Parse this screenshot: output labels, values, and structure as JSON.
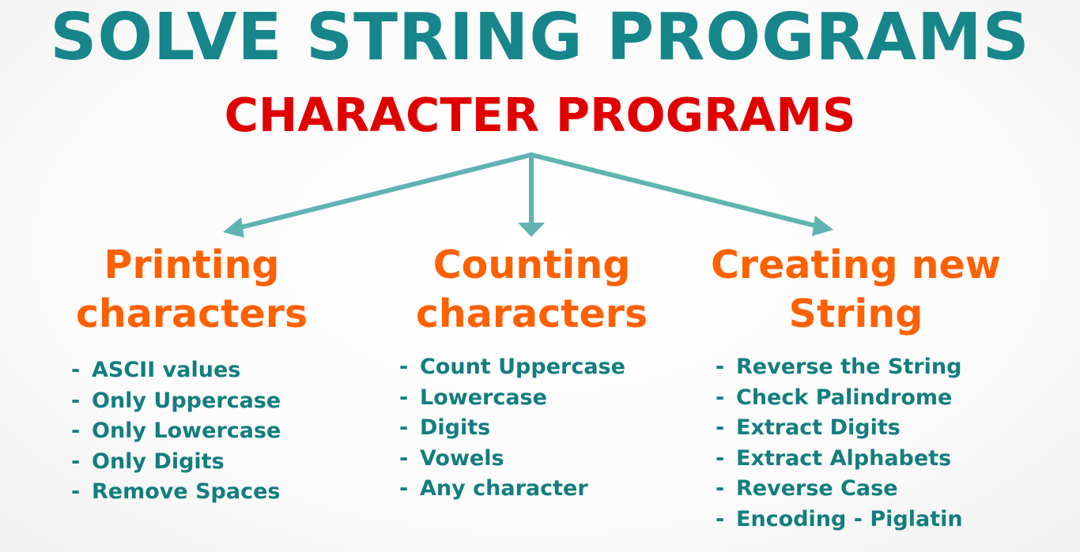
{
  "colors": {
    "teal": "#16868b",
    "red": "#e10000",
    "orange": "#ff6000",
    "arrow": "#5fb3b0",
    "item_text": "#137d7f"
  },
  "title": "SOLVE STRING PROGRAMS",
  "subtitle": "CHARACTER PROGRAMS",
  "categories": [
    {
      "heading_line1": "Printing",
      "heading_line2": "characters",
      "items": [
        "ASCII values",
        "Only Uppercase",
        "Only Lowercase",
        "Only Digits",
        "Remove Spaces"
      ]
    },
    {
      "heading_line1": "Counting",
      "heading_line2": "characters",
      "items": [
        "Count Uppercase",
        "Lowercase",
        "Digits",
        "Vowels",
        "Any character"
      ]
    },
    {
      "heading_line1": "Creating new",
      "heading_line2": "String",
      "items": [
        "Reverse the String",
        "Check Palindrome",
        "Extract Digits",
        "Extract Alphabets",
        "Reverse Case",
        "Encoding - Piglatin"
      ]
    }
  ]
}
